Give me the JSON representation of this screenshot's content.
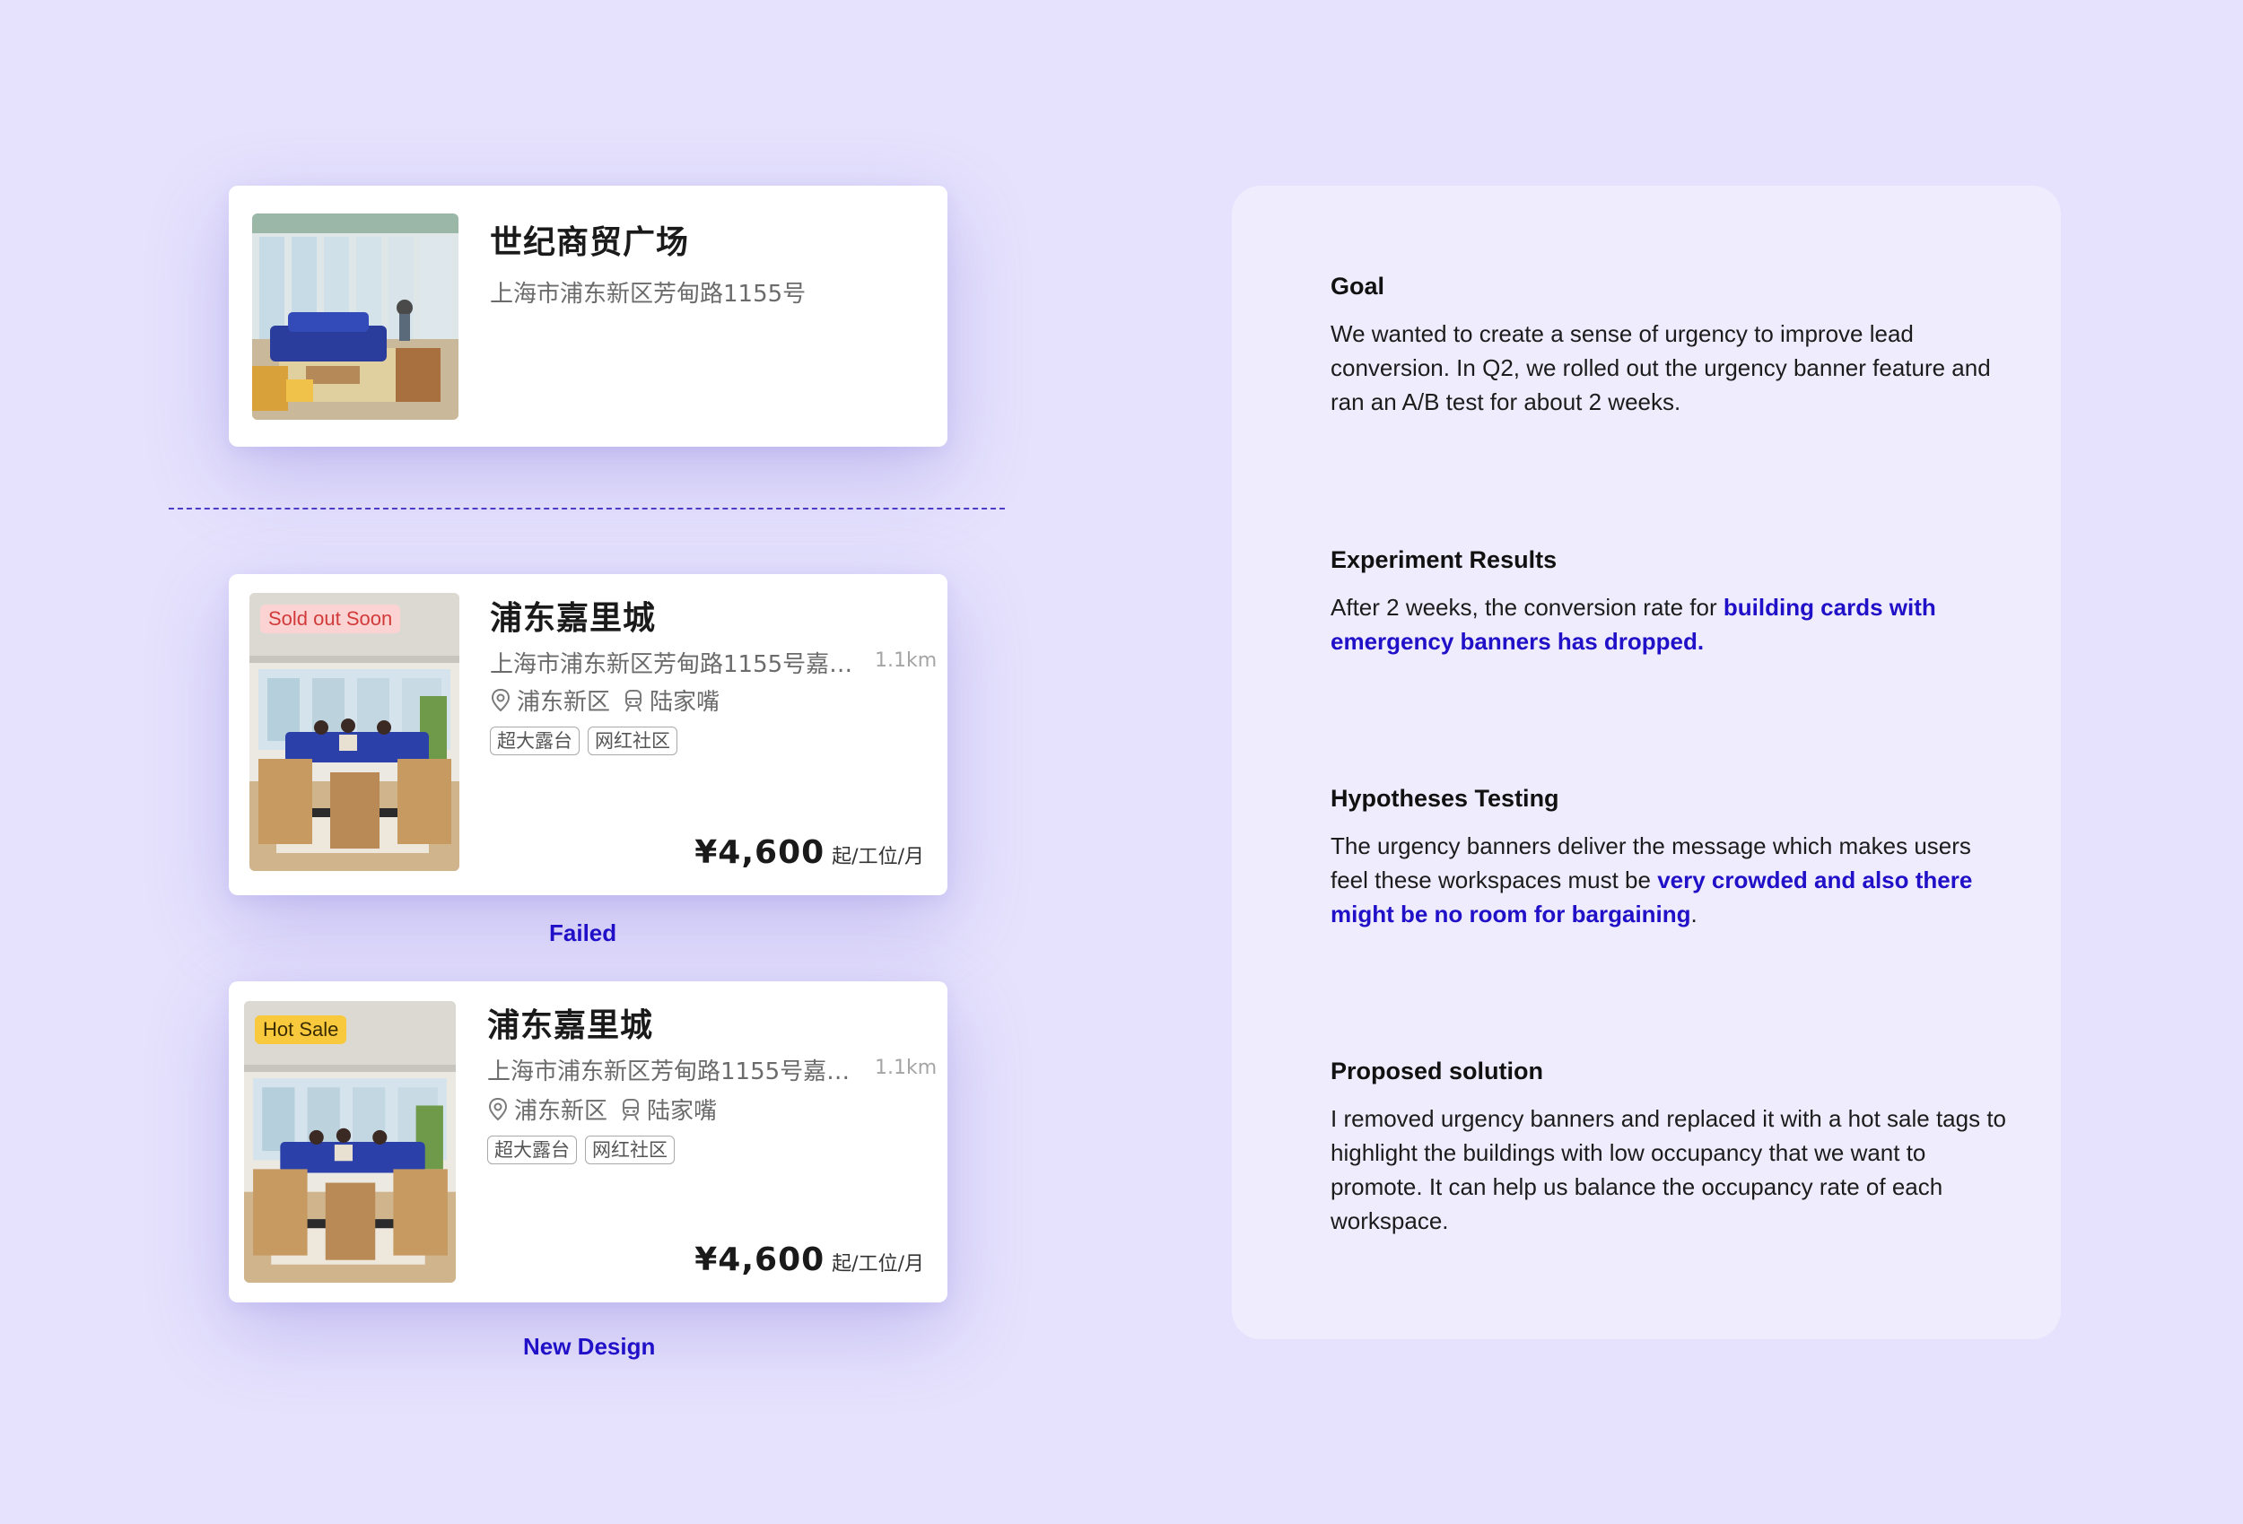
{
  "card_top": {
    "title": "世纪商贸广场",
    "address": "上海市浦东新区芳甸路1155号"
  },
  "card_failed": {
    "badge": "Sold out Soon",
    "title": "浦东嘉里城",
    "address": "上海市浦东新区芳甸路1155号嘉…",
    "distance": "1.1km",
    "district": "浦东新区",
    "station": "陆家嘴",
    "tags": [
      "超大露台",
      "网红社区"
    ],
    "price": "¥4,600",
    "price_unit": "起/工位/月",
    "badge_bg": "#fbd3d3",
    "badge_color": "#d23a3a"
  },
  "caption_failed": "Failed",
  "card_new": {
    "badge": "Hot Sale",
    "title": "浦东嘉里城",
    "address": "上海市浦东新区芳甸路1155号嘉…",
    "distance": "1.1km",
    "district": "浦东新区",
    "station": "陆家嘴",
    "tags": [
      "超大露台",
      "网红社区"
    ],
    "price": "¥4,600",
    "price_unit": "起/工位/月",
    "badge_bg": "#f8c93c",
    "badge_color": "#3a2c00"
  },
  "caption_new": "New Design",
  "panel": {
    "goal": {
      "heading": "Goal",
      "text": "We wanted to create a sense of urgency to improve lead conversion. In Q2, we rolled out the urgency banner feature and ran an A/B test for about 2 weeks."
    },
    "results": {
      "heading": "Experiment Results",
      "text_before": "After 2 weeks, the conversion rate for ",
      "text_highlight": "building cards with emergency banners has dropped."
    },
    "hypotheses": {
      "heading": "Hypotheses Testing",
      "text_before": "The urgency banners deliver the message which makes users feel these workspaces must be ",
      "text_highlight": "very crowded and also there might be no room for bargaining",
      "text_after": "."
    },
    "solution": {
      "heading": "Proposed solution",
      "text": "I removed urgency banners and replaced it with a hot sale tags to highlight the buildings with low occupancy that we want to promote. It can help us balance the occupancy rate of each workspace."
    }
  },
  "colors": {
    "background": "#e6e2fd",
    "panel": "#efecfd",
    "accent": "#2010c8"
  }
}
